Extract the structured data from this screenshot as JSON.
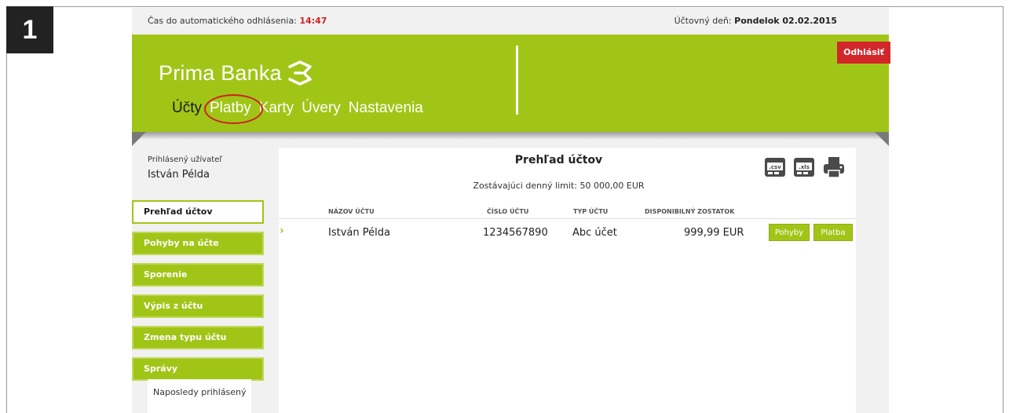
{
  "step_badge": "1",
  "topbar": {
    "timeout_label": "Čas do automatického odhlásenia:",
    "timeout_value": "14:47",
    "date_label": "Účtovný deň:",
    "date_value": "Pondelok 02.02.2015"
  },
  "header": {
    "logo_text": "Prima Banka",
    "logout_label": "Odhlásiť",
    "nav": [
      {
        "label": "Účty"
      },
      {
        "label": "Platby"
      },
      {
        "label": "Karty"
      },
      {
        "label": "Úvery"
      },
      {
        "label": "Nastavenia"
      }
    ]
  },
  "user": {
    "caption": "Prihlásený užívateľ",
    "name": "István Példa"
  },
  "sidebar": {
    "items": [
      {
        "label": "Prehľad účtov"
      },
      {
        "label": "Pohyby na účte"
      },
      {
        "label": "Sporenie"
      },
      {
        "label": "Výpis z účtu"
      },
      {
        "label": "Zmena typu účtu"
      },
      {
        "label": "Správy"
      }
    ],
    "last_login_label": "Naposledy prihlásený"
  },
  "content": {
    "title": "Prehľad účtov",
    "limit": "Zostávajúci denný limit: 50 000,00 EUR",
    "icons": [
      "csv-export-icon",
      "xls-export-icon",
      "print-icon"
    ],
    "columns": {
      "name": "NÁZOV ÚČTU",
      "number": "ČÍSLO ÚČTU",
      "type": "TYP ÚČTU",
      "balance": "DISPONIBILNÝ ZOSTATOK"
    },
    "rows": [
      {
        "name": "István Példa",
        "number": "1234567890",
        "type": "Abc účet",
        "balance": "999,99 EUR",
        "btn_movements": "Pohyby",
        "btn_payment": "Platba"
      }
    ]
  },
  "colors": {
    "brand_green": "#a1c517",
    "logout_red": "#d3262a",
    "timer_red": "#d2231f"
  }
}
